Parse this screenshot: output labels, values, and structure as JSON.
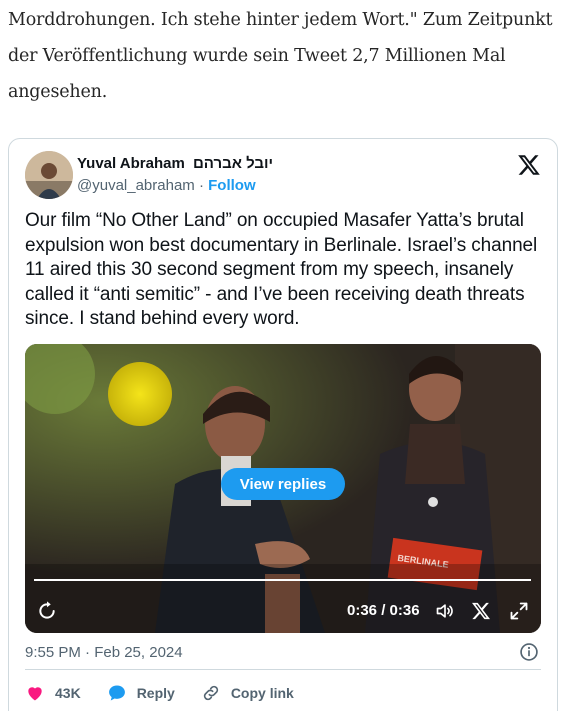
{
  "article": {
    "text": "Morddrohungen. Ich stehe hinter jedem Wort.\" Zum Zeitpunkt der Veröffentlichung wurde sein Tweet 2,7 Millionen Mal angesehen."
  },
  "tweet": {
    "author_name": "Yuval Abraham",
    "author_name_hebrew": "יובל אברהם",
    "handle": "@yuval_abraham",
    "separator": " · ",
    "follow_label": "Follow",
    "text": "Our film “No Other Land” on occupied Masafer Yatta’s brutal expulsion won best documentary in Berlinale. Israel’s channel 11 aired this 30 second segment from my speech, insanely called it “anti semitic” - and I’ve been receiving death threats since. I stand behind every word.",
    "video": {
      "view_replies_label": "View replies",
      "time": "0:36 / 0:36",
      "progress": 1.0
    },
    "timestamp": "9:55 PM · Feb 25, 2024",
    "actions": {
      "likes": "43K",
      "reply_label": "Reply",
      "copy_link_label": "Copy link"
    }
  },
  "colors": {
    "accent": "#1d9bf0",
    "like": "#f91880",
    "muted_text": "#536471",
    "border": "#cfd9de"
  },
  "icons": [
    "x-logo-icon",
    "replay-icon",
    "volume-icon",
    "fullscreen-icon",
    "info-icon",
    "heart-icon",
    "reply-bubble-icon",
    "link-icon"
  ]
}
